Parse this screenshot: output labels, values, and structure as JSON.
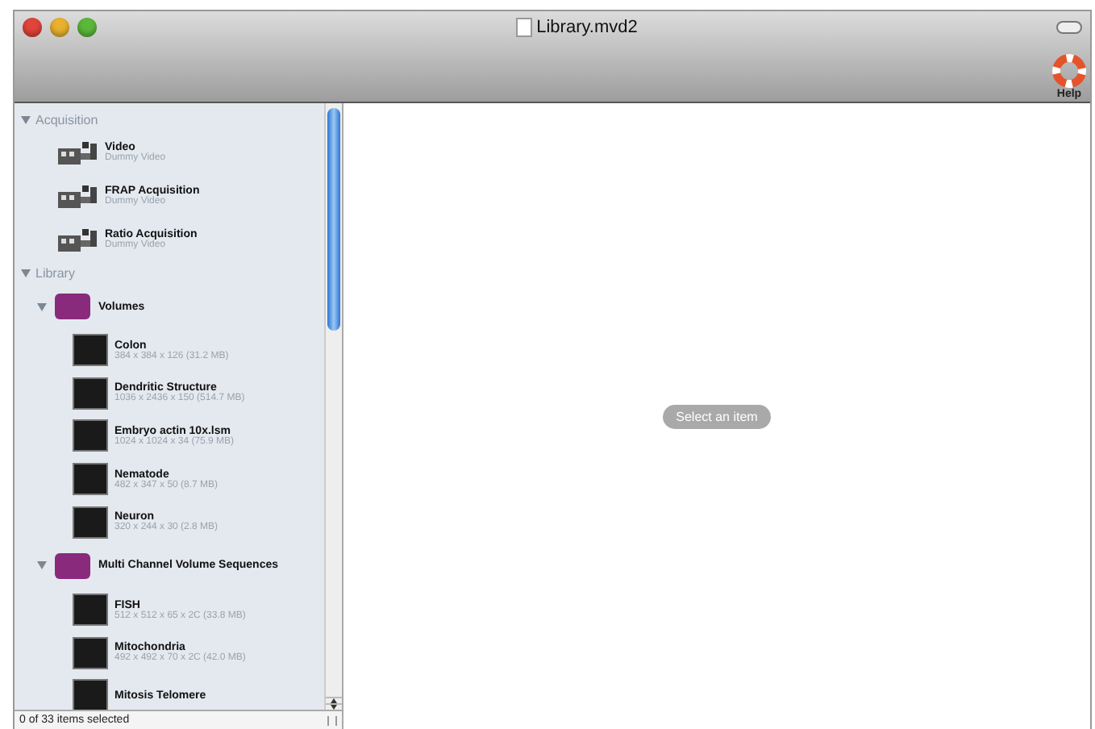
{
  "window": {
    "title": "Library.mvd2"
  },
  "toolbar": {
    "help_label": "Help"
  },
  "sidebar": {
    "sections": [
      {
        "label": "Acquisition",
        "expanded": true,
        "children": [
          {
            "kind": "acquisition",
            "title": "Video",
            "subtitle": "Dummy Video"
          },
          {
            "kind": "acquisition",
            "title": "FRAP Acquisition",
            "subtitle": "Dummy Video"
          },
          {
            "kind": "acquisition",
            "title": "Ratio Acquisition",
            "subtitle": "Dummy Video"
          }
        ]
      },
      {
        "label": "Library",
        "expanded": true,
        "children": [
          {
            "kind": "folder",
            "title": "Volumes",
            "expanded": true,
            "children": [
              {
                "kind": "image",
                "title": "Colon",
                "subtitle": "384 x 384 x 126 (31.2 MB)"
              },
              {
                "kind": "image",
                "title": "Dendritic Structure",
                "subtitle": "1036 x 2436 x 150 (514.7 MB)"
              },
              {
                "kind": "image",
                "title": "Embryo actin 10x.lsm",
                "subtitle": "1024 x 1024 x 34 (75.9 MB)"
              },
              {
                "kind": "image",
                "title": "Nematode",
                "subtitle": "482 x 347 x 50 (8.7 MB)"
              },
              {
                "kind": "image",
                "title": "Neuron",
                "subtitle": "320 x 244 x 30 (2.8 MB)"
              }
            ]
          },
          {
            "kind": "folder",
            "title": "Multi Channel Volume Sequences",
            "expanded": true,
            "children": [
              {
                "kind": "image",
                "title": "FISH",
                "subtitle": "512 x 512 x 65 x 2C (33.8 MB)"
              },
              {
                "kind": "image",
                "title": "Mitochondria",
                "subtitle": "492 x 492 x 70 x 2C (42.0 MB)"
              },
              {
                "kind": "image",
                "title": "Mitosis Telomere"
              }
            ]
          }
        ]
      }
    ],
    "status": "0 of 33 items selected"
  },
  "content": {
    "placeholder_label": "Select an item"
  }
}
